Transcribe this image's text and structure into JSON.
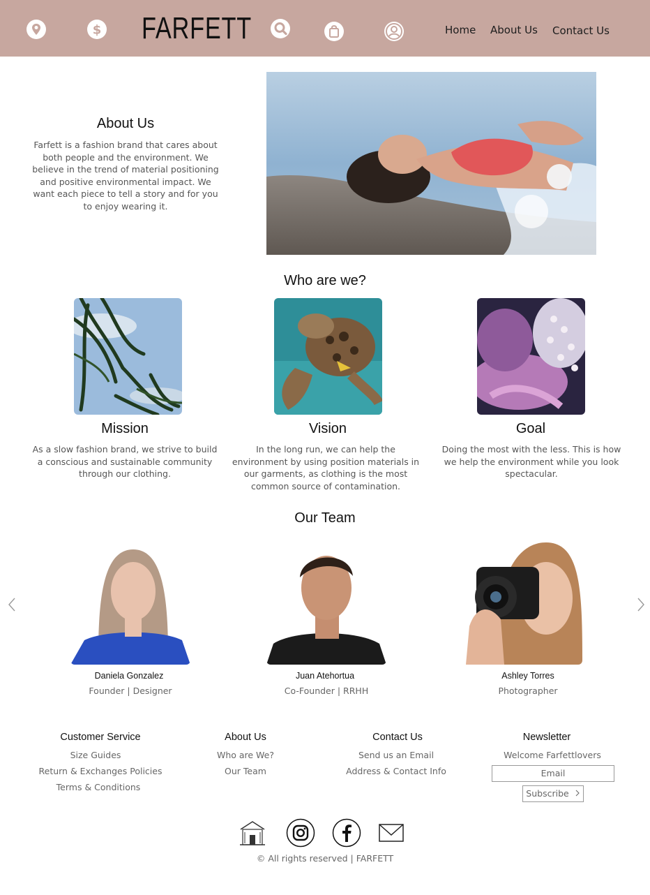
{
  "header": {
    "brand": "FARFETT",
    "icons": [
      "location-icon",
      "dollar-icon",
      "search-icon",
      "shopping-bag-icon",
      "user-icon"
    ],
    "nav": [
      "Home",
      "About Us",
      "Contact Us"
    ],
    "background": "#c7a79f"
  },
  "about": {
    "title": "About Us",
    "text": "Farfett is a fashion brand that cares about both people and the environment. We believe in the trend of material positioning and positive environmental impact. We want each piece to tell a story and for you to enjoy wearing it."
  },
  "who": {
    "title": "Who are we?",
    "cards": [
      {
        "title": "Mission",
        "text": "As a slow fashion brand, we strive to build a conscious and sustainable community through our clothing."
      },
      {
        "title": "Vision",
        "text": "In the long run, we can help the environment by using position materials in our garments, as clothing is the most common source of contamination."
      },
      {
        "title": "Goal",
        "text": "Doing the most with the less. This is how we help the environment while you look spectacular."
      }
    ]
  },
  "team": {
    "title": "Our Team",
    "members": [
      {
        "name": "Daniela Gonzalez",
        "role": "Founder | Designer"
      },
      {
        "name": "Juan Atehortua",
        "role": "Co-Founder | RRHH"
      },
      {
        "name": "Ashley Torres",
        "role": "Photographer"
      }
    ]
  },
  "footer": {
    "columns": [
      {
        "title": "Customer Service",
        "links": [
          "Size Guides",
          "Return & Exchanges Policies",
          "Terms & Conditions"
        ]
      },
      {
        "title": "About Us",
        "links": [
          "Who are We?",
          "Our Team"
        ]
      },
      {
        "title": "Contact Us",
        "links": [
          "Send us an Email",
          "Address & Contact Info"
        ]
      },
      {
        "title": "Newsletter",
        "links": [
          "Welcome Farfettlovers"
        ]
      }
    ],
    "email_placeholder": "Email",
    "subscribe_label": "Subscribe",
    "social_icons": [
      "shop-logo-icon",
      "instagram-icon",
      "facebook-icon",
      "mail-icon"
    ],
    "copyright": "© All rights reserved | FARFETT"
  }
}
